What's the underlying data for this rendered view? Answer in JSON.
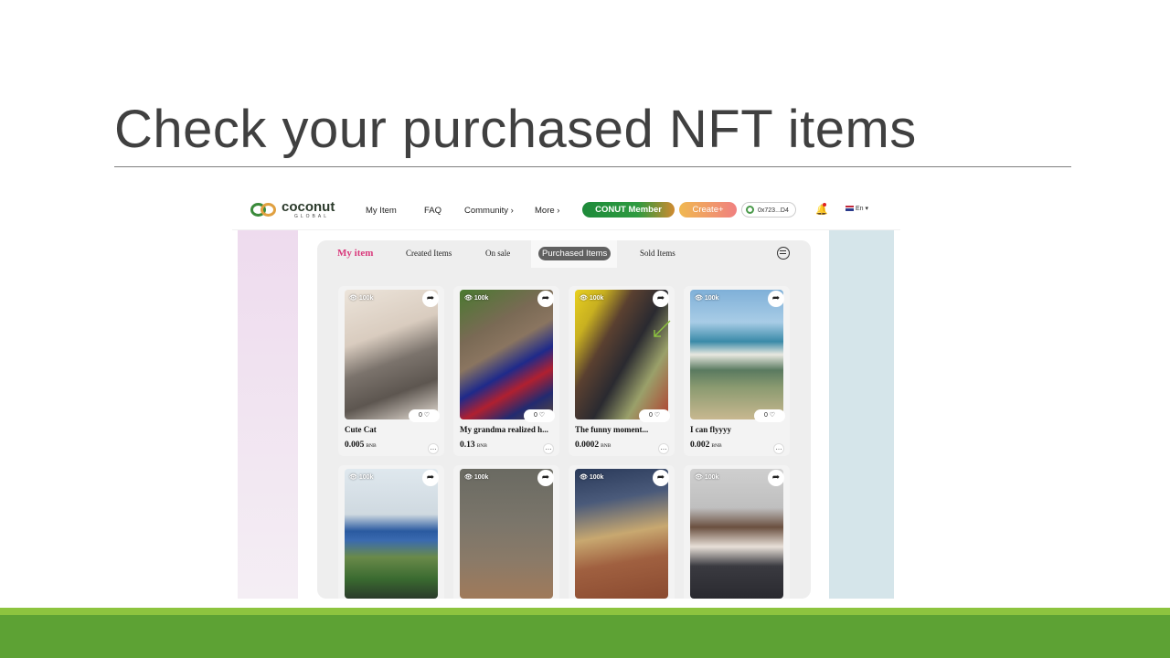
{
  "slide": {
    "title": "Check your purchased NFT items"
  },
  "nav": {
    "logo_main": "coconut",
    "logo_sub": "GLOBAL",
    "links": [
      "My Item",
      "FAQ",
      "Community ›",
      "More ›"
    ],
    "member_button": "CONUT Member",
    "create_button": "Create+",
    "wallet": "0x723...D4",
    "language": "En ▾"
  },
  "tabs": {
    "my_item": "My item",
    "created": "Created Items",
    "on_sale": "On sale",
    "purchased": "Purchased Items",
    "sold": "Sold Items"
  },
  "items": [
    {
      "views": "100k",
      "likes": "0 ♡",
      "name": "Cute Cat",
      "price": "0.005",
      "unit": "BNB"
    },
    {
      "views": "100k",
      "likes": "0 ♡",
      "name": "My grandma realized h...",
      "price": "0.13",
      "unit": "BNB"
    },
    {
      "views": "100k",
      "likes": "0 ♡",
      "name": "The funny moment...",
      "price": "0.0002",
      "unit": "BNB"
    },
    {
      "views": "100k",
      "likes": "0 ♡",
      "name": "I can flyyyy",
      "price": "0.002",
      "unit": "BNB"
    },
    {
      "views": "100k",
      "likes": "",
      "name": "",
      "price": "",
      "unit": ""
    },
    {
      "views": "100k",
      "likes": "",
      "name": "",
      "price": "",
      "unit": ""
    },
    {
      "views": "100k",
      "likes": "",
      "name": "",
      "price": "",
      "unit": ""
    },
    {
      "views": "100k",
      "likes": "",
      "name": "",
      "price": "",
      "unit": ""
    }
  ],
  "colors": {
    "accent_pink": "#d93a7c",
    "member_green": "#1e8a3a",
    "footer_green": "#5da234"
  }
}
